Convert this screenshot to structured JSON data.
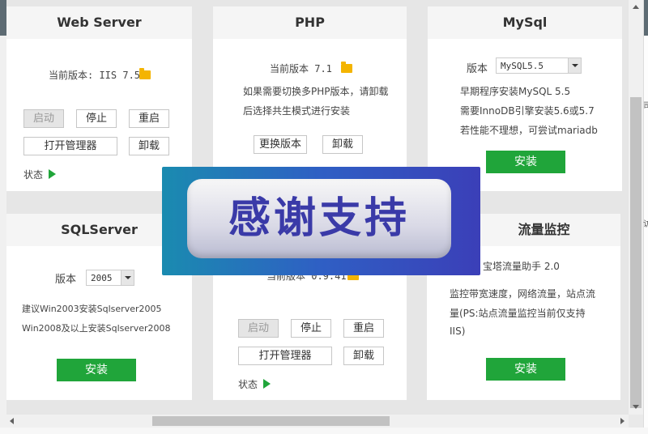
{
  "web_server": {
    "title": "Web Server",
    "version_label": "当前版本: IIS 7.5",
    "start": "启动",
    "stop": "停止",
    "restart": "重启",
    "open_manager": "打开管理器",
    "uninstall": "卸载",
    "status": "状态"
  },
  "php": {
    "title": "PHP",
    "version_label": "当前版本 7.1",
    "note_line1": "如果需要切换多PHP版本，请卸载",
    "note_line2": "后选择共生模式进行安装",
    "change_version": "更换版本",
    "uninstall": "卸载"
  },
  "mysql": {
    "title": "MySql",
    "version_label": "版本",
    "selected_version": "MySQL5.5",
    "note_line1": "早期程序安装MySQL 5.5",
    "note_line2": "需要InnoDB引擎安装5.6或5.7",
    "note_line3": "若性能不理想，可尝试mariadb",
    "install": "安装"
  },
  "sqlserver": {
    "title": "SQLServer",
    "version_label": "版本",
    "selected_version": "2005",
    "note_line1": "建议Win2003安装Sqlserver2005",
    "note_line2": "Win2008及以上安装Sqlserver2008",
    "install": "安装"
  },
  "ftp": {
    "version_label": "当前版本 0.9.41",
    "start": "启动",
    "stop": "停止",
    "restart": "重启",
    "open_manager": "打开管理器",
    "uninstall": "卸载",
    "status": "状态"
  },
  "traffic": {
    "title": "流量监控",
    "product": "宝塔流量助手 2.0",
    "note_line1": "监控带宽速度，网络流量，站点流",
    "note_line2": "量(PS:站点流量监控当前仅支持",
    "note_line3": "IIS)",
    "install": "安装"
  },
  "overlay": {
    "text": "感谢支持"
  },
  "side_glyphs": [
    "司",
    "访"
  ],
  "colors": {
    "accent_green": "#20a53a",
    "folder_yellow": "#f4b400"
  }
}
